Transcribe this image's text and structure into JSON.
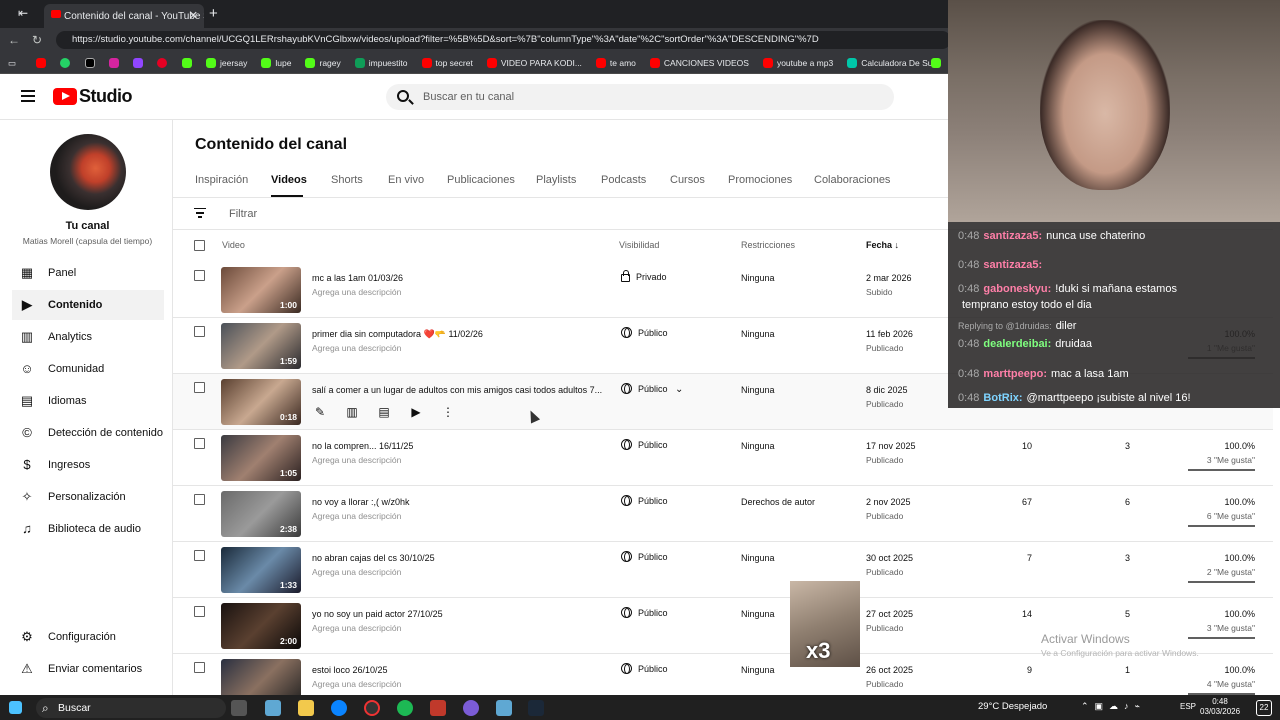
{
  "browser": {
    "tab_title": "Contenido del canal - YouTube Studio",
    "url": "https://studio.youtube.com/channel/UCGQ1LERrshayubKVnCGlbxw/videos/upload?filter=%5B%5D&sort=%7B\"columnType\"%3A\"date\"%2C\"sortOrder\"%3A\"DESCENDING\"%7D",
    "bookmarks": [
      {
        "label": "jeersay",
        "color": "#53fc18"
      },
      {
        "label": "lupe",
        "color": "#53fc18"
      },
      {
        "label": "ragey",
        "color": "#53fc18"
      },
      {
        "label": "impuestito",
        "color": "#0f9d58"
      },
      {
        "label": "top secret",
        "color": "#ff0000"
      },
      {
        "label": "VIDEO PARA KODI...",
        "color": "#ff0000"
      },
      {
        "label": "te amo",
        "color": "#ff0000"
      },
      {
        "label": "CANCIONES VIDEOS",
        "color": "#ff0000"
      },
      {
        "label": "youtube a mp3",
        "color": "#ff0000"
      },
      {
        "label": "Calculadora De Su...",
        "color": "#00c7a9"
      }
    ]
  },
  "header": {
    "logo": "Studio",
    "search_placeholder": "Buscar en tu canal"
  },
  "channel": {
    "title": "Tu canal",
    "subtitle": "Matias Morell (capsula del tiempo)"
  },
  "nav": {
    "items": [
      {
        "label": "Panel",
        "icon": "dashboard-icon"
      },
      {
        "label": "Contenido",
        "icon": "content-icon"
      },
      {
        "label": "Analytics",
        "icon": "analytics-icon"
      },
      {
        "label": "Comunidad",
        "icon": "community-icon"
      },
      {
        "label": "Idiomas",
        "icon": "subtitles-icon"
      },
      {
        "label": "Detección de contenido",
        "icon": "copyright-icon"
      },
      {
        "label": "Ingresos",
        "icon": "earn-icon"
      },
      {
        "label": "Personalización",
        "icon": "customize-icon"
      },
      {
        "label": "Biblioteca de audio",
        "icon": "audio-library-icon"
      }
    ],
    "bottom": [
      {
        "label": "Configuración",
        "icon": "gear-icon"
      },
      {
        "label": "Enviar comentarios",
        "icon": "feedback-icon"
      }
    ]
  },
  "main": {
    "title": "Contenido del canal",
    "tabs": [
      "Inspiración",
      "Videos",
      "Shorts",
      "En vivo",
      "Publicaciones",
      "Playlists",
      "Podcasts",
      "Cursos",
      "Promociones",
      "Colaboraciones"
    ],
    "active_tab": "Videos",
    "filter_placeholder": "Filtrar",
    "columns": {
      "video": "Video",
      "visibility": "Visibilidad",
      "restrictions": "Restricciones",
      "date": "Fecha"
    },
    "rows": [
      {
        "title": "mc a las 1am 01/03/26",
        "desc": "Agrega una descripción",
        "duration": "1:00",
        "visibility": "Privado",
        "restrictions": "Ninguna",
        "date": "2 mar 2026",
        "status": "Subido",
        "views": "",
        "comments": "",
        "pct": "",
        "likes": ""
      },
      {
        "title": "primer dia sin computadora ❤️🫳 11/02/26",
        "desc": "Agrega una descripción",
        "duration": "1:59",
        "visibility": "Público",
        "restrictions": "Ninguna",
        "date": "11 feb 2026",
        "status": "Publicado",
        "views": "",
        "comments": "",
        "pct": "100.0%",
        "likes": "1 \"Me gusta\""
      },
      {
        "title": "salí a comer a un lugar de adultos con mis amigos casi todos adultos 7...",
        "desc": "",
        "duration": "0:18",
        "visibility": "Público",
        "restrictions": "Ninguna",
        "date": "8 dic 2025",
        "status": "Publicado",
        "views": "",
        "comments": "",
        "pct": "",
        "likes": ""
      },
      {
        "title": "no la compren... 16/11/25",
        "desc": "Agrega una descripción",
        "duration": "1:05",
        "visibility": "Público",
        "restrictions": "Ninguna",
        "date": "17 nov 2025",
        "status": "Publicado",
        "views": "10",
        "comments": "3",
        "pct": "100.0%",
        "likes": "3 \"Me gusta\""
      },
      {
        "title": "no voy a llorar :,( w/z0hk",
        "desc": "Agrega una descripción",
        "duration": "2:38",
        "visibility": "Público",
        "restrictions": "Derechos de autor",
        "date": "2 nov 2025",
        "status": "Publicado",
        "views": "67",
        "comments": "6",
        "pct": "100.0%",
        "likes": "6 \"Me gusta\""
      },
      {
        "title": "no abran cajas del cs 30/10/25",
        "desc": "Agrega una descripción",
        "duration": "1:33",
        "visibility": "Público",
        "restrictions": "Ninguna",
        "date": "30 oct 2025",
        "status": "Publicado",
        "views": "7",
        "comments": "3",
        "pct": "100.0%",
        "likes": "2 \"Me gusta\""
      },
      {
        "title": "yo no soy un paid actor 27/10/25",
        "desc": "Agrega una descripción",
        "duration": "2:00",
        "visibility": "Público",
        "restrictions": "Ninguna",
        "date": "27 oct 2025",
        "status": "Publicado",
        "views": "14",
        "comments": "5",
        "pct": "100.0%",
        "likes": "3 \"Me gusta\""
      },
      {
        "title": "estoi loco 26/10/25",
        "desc": "Agrega una descripción",
        "duration": "",
        "visibility": "Público",
        "restrictions": "Ninguna",
        "date": "26 oct 2025",
        "status": "Publicado",
        "views": "9",
        "comments": "1",
        "pct": "100.0%",
        "likes": "4 \"Me gusta\""
      }
    ]
  },
  "chat": {
    "lines": [
      {
        "time": "0:48",
        "user": "santizaza5:",
        "user_color": "#ff7fa8",
        "msg": "nunca use chaterino"
      },
      {
        "time": "0:48",
        "user": "santizaza5:",
        "user_color": "#ff7fa8",
        "msg": ""
      },
      {
        "time": "0:48",
        "user": "gaboneskyu:",
        "user_color": "#ff7fa8",
        "msg": "!duki si mañana estamos"
      },
      {
        "time": "",
        "user": "",
        "user_color": "#ffffff",
        "msg": "temprano estoy todo el dia"
      },
      {
        "time": "",
        "user": "Replying to @1druidas:",
        "user_color": "#aaaaaa",
        "msg": "diler"
      },
      {
        "time": "0:48",
        "user": "dealerdeibai:",
        "user_color": "#7fff7f",
        "msg": "druidaa"
      },
      {
        "time": "0:48",
        "user": "marttpeepo:",
        "user_color": "#ff7fa8",
        "msg": "mac a lasa 1am"
      },
      {
        "time": "0:48",
        "user": "BotRix:",
        "user_color": "#7fd4ff",
        "msg": "@marttpeepo ¡subiste al nivel 16!"
      }
    ]
  },
  "overlay": {
    "activate_title": "Activar Windows",
    "activate_sub": "Ve a Configuración para activar Windows.",
    "cats_text": "x3"
  },
  "taskbar": {
    "search": "Buscar",
    "weather": "29°C  Despejado",
    "lang": "ESP",
    "time": "0:48",
    "date": "03/03/2026",
    "badge": "22"
  }
}
